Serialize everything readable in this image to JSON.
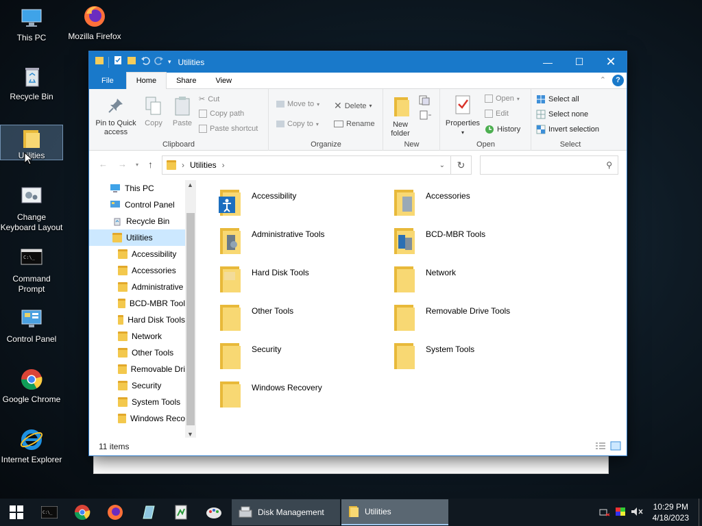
{
  "desktop": {
    "icons": [
      {
        "label": "This PC",
        "icon": "this-pc-icon"
      },
      {
        "label": "Mozilla Firefox",
        "icon": "firefox-icon"
      },
      {
        "label": "Recycle Bin",
        "icon": "recycle-bin-icon"
      },
      {
        "label": "Utilities",
        "icon": "folder-icon"
      },
      {
        "label": "Change Keyboard Layout",
        "icon": "keyboard-layout-icon"
      },
      {
        "label": "Command Prompt",
        "icon": "command-prompt-icon"
      },
      {
        "label": "Control Panel",
        "icon": "control-panel-icon"
      },
      {
        "label": "Google Chrome",
        "icon": "chrome-icon"
      },
      {
        "label": "Internet Explorer",
        "icon": "internet-explorer-icon"
      }
    ]
  },
  "window": {
    "title": "Utilities",
    "tabs": [
      "File",
      "Home",
      "Share",
      "View"
    ],
    "ribbon": {
      "clipboard": {
        "group": "Clipboard",
        "pin": "Pin to Quick access",
        "copy": "Copy",
        "paste": "Paste",
        "cut": "Cut",
        "copy_path": "Copy path",
        "paste_shortcut": "Paste shortcut"
      },
      "organize": {
        "group": "Organize",
        "move_to": "Move to",
        "copy_to": "Copy to",
        "delete": "Delete",
        "rename": "Rename"
      },
      "new": {
        "group": "New",
        "new_folder": "New folder"
      },
      "open": {
        "group": "Open",
        "properties": "Properties",
        "open": "Open",
        "edit": "Edit",
        "history": "History"
      },
      "select": {
        "group": "Select",
        "select_all": "Select all",
        "select_none": "Select none",
        "invert": "Invert selection"
      }
    },
    "address": {
      "path": "Utilities"
    },
    "nav": [
      {
        "label": "This PC",
        "level": 0
      },
      {
        "label": "Control Panel",
        "level": 0
      },
      {
        "label": "Recycle Bin",
        "level": 0
      },
      {
        "label": "Utilities",
        "level": 0,
        "selected": true
      },
      {
        "label": "Accessibility",
        "level": 1
      },
      {
        "label": "Accessories",
        "level": 1
      },
      {
        "label": "Administrative",
        "level": 1
      },
      {
        "label": "BCD-MBR Tool",
        "level": 1
      },
      {
        "label": "Hard Disk Tools",
        "level": 1
      },
      {
        "label": "Network",
        "level": 1
      },
      {
        "label": "Other Tools",
        "level": 1
      },
      {
        "label": "Removable Dri",
        "level": 1
      },
      {
        "label": "Security",
        "level": 1
      },
      {
        "label": "System Tools",
        "level": 1
      },
      {
        "label": "Windows Reco",
        "level": 1
      }
    ],
    "items": [
      "Accessibility",
      "Accessories",
      "Administrative Tools",
      "BCD-MBR Tools",
      "Hard Disk Tools",
      "Network",
      "Other Tools",
      "Removable Drive Tools",
      "Security",
      "System Tools",
      "Windows Recovery"
    ],
    "status": "11 items"
  },
  "taskbar": {
    "apps": [
      {
        "label": "Disk Management"
      },
      {
        "label": "Utilities"
      }
    ],
    "time": "10:29 PM",
    "date": "4/18/2023"
  },
  "colors": {
    "accent": "#1979ca",
    "folder": "#f5cd5b",
    "selection": "#cce8ff"
  }
}
